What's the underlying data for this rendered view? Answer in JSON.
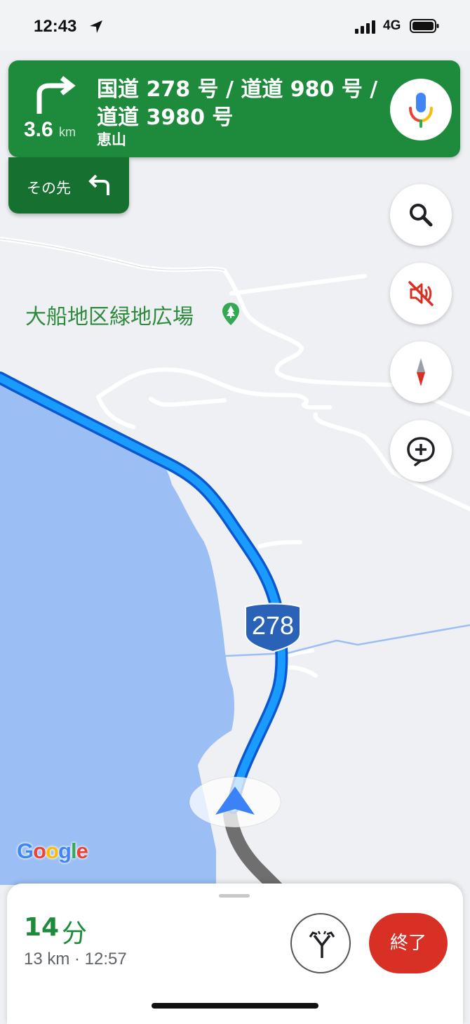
{
  "status_bar": {
    "time": "12:43",
    "network": "4G"
  },
  "navigation": {
    "distance": "3.6",
    "distance_unit": "km",
    "road_line1": "国道 278 号 / 道道 980 号 /",
    "road_line2": "道道 3980 号",
    "place": "恵山",
    "then_label": "その先"
  },
  "map": {
    "poi_label": "大船地区緑地広場",
    "route_number": "278",
    "logo": "Google"
  },
  "trip": {
    "minutes": "14",
    "minutes_unit": "分",
    "details": "13 km · 12:57",
    "exit_label": "終了"
  },
  "colors": {
    "nav_green": "#1e8a3c",
    "route_blue": "#1a73e8",
    "water": "#9bbff5",
    "exit_red": "#d93025"
  },
  "icons": [
    "turn-right-icon",
    "turn-left-icon",
    "mic-icon",
    "search-icon",
    "mute-icon",
    "compass-icon",
    "add-report-icon",
    "alternate-routes-icon",
    "navigation-arrow-icon",
    "park-pin-icon"
  ]
}
